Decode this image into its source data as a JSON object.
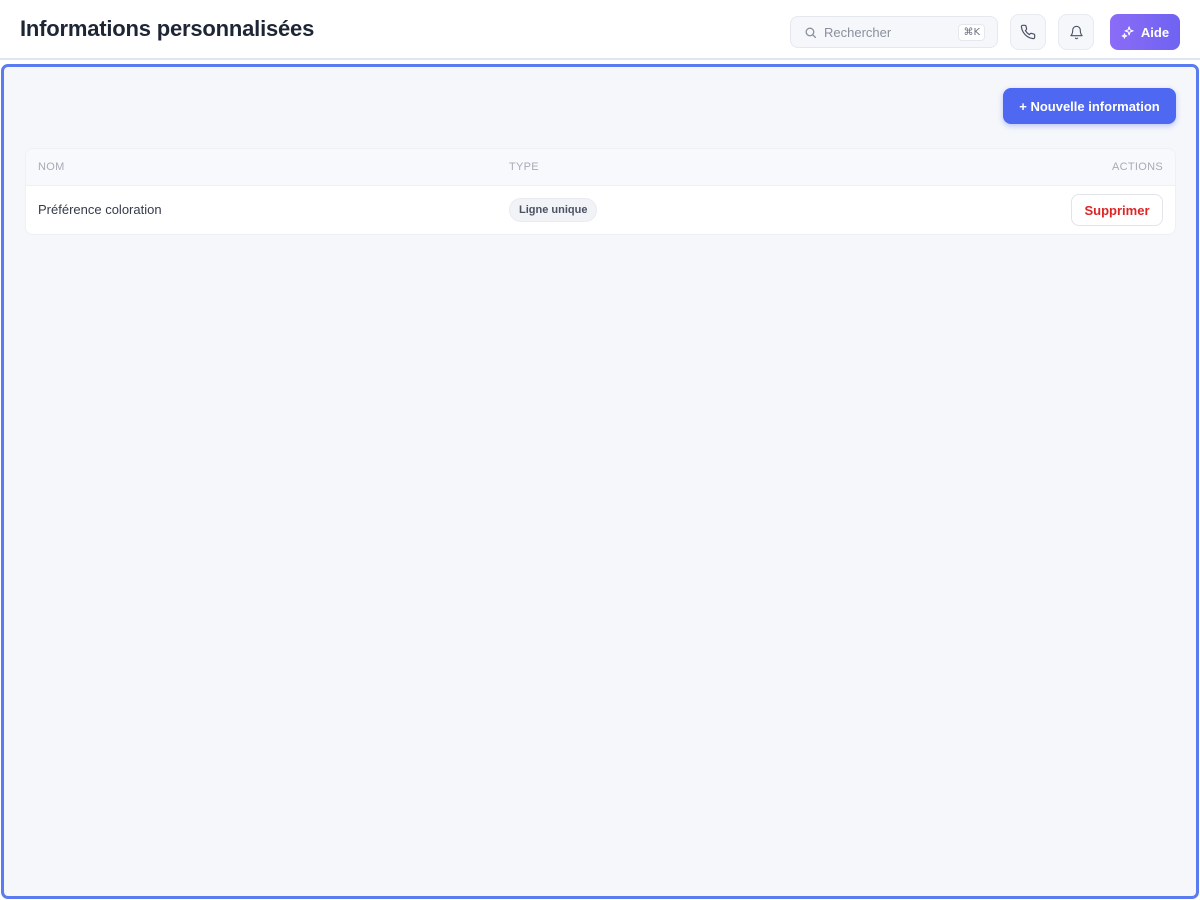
{
  "header": {
    "title": "Informations personnalisées",
    "search": {
      "placeholder": "Rechercher",
      "shortcut": "⌘K"
    },
    "help_label": "Aide",
    "icons": {
      "search": "search-icon",
      "phone": "phone-icon",
      "bell": "bell-icon",
      "help": "sparkles-icon"
    }
  },
  "main": {
    "new_button_label": "+ Nouvelle information",
    "table": {
      "columns": {
        "name": "NOM",
        "type": "TYPE",
        "actions": "ACTIONS"
      },
      "rows": [
        {
          "name": "Préférence coloration",
          "type": "Ligne unique",
          "action_label": "Supprimer"
        }
      ]
    }
  },
  "colors": {
    "accent": "#4e68f2",
    "help_gradient_start": "#8b6cf6",
    "help_gradient_end": "#6f63f2",
    "danger": "#dc2626",
    "frame_border": "#5b7cf0",
    "background": "#f5f7fb"
  }
}
